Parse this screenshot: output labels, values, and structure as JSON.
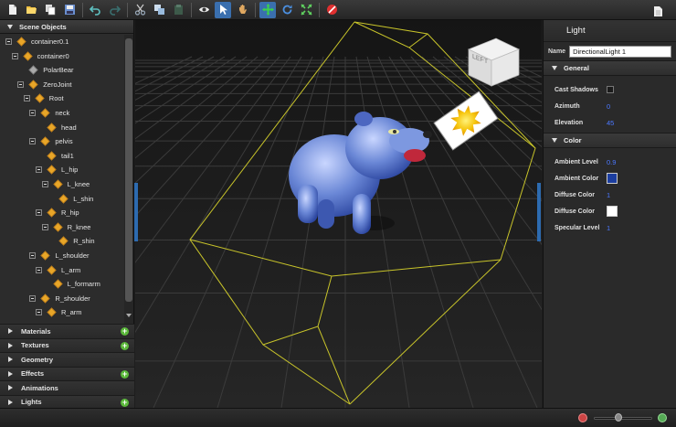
{
  "toolbar": {
    "buttons": [
      "new-file-icon",
      "open-folder-icon",
      "copy-icon",
      "save-icon",
      "undo-icon",
      "redo-icon",
      "cut-icon",
      "duplicate-icon",
      "paste-icon",
      "eye-icon",
      "select-arrow-icon",
      "pan-hand-icon",
      "move-icon",
      "rotate-icon",
      "scale-icon",
      "stop-icon"
    ],
    "active": "select-arrow-icon",
    "right_button": "document-icon"
  },
  "scene_objects": {
    "title": "Scene Objects",
    "tree": [
      {
        "label": "container0.1",
        "level": 0,
        "expandable": true,
        "icon": "cube-orange"
      },
      {
        "label": "container0",
        "level": 1,
        "expandable": true,
        "icon": "cube-orange"
      },
      {
        "label": "PolarBear",
        "level": 2,
        "expandable": false,
        "icon": "cube-gray"
      },
      {
        "label": "ZeroJoint",
        "level": 2,
        "expandable": true,
        "icon": "cube-orange"
      },
      {
        "label": "Root",
        "level": 3,
        "expandable": true,
        "icon": "cube-orange"
      },
      {
        "label": "neck",
        "level": 4,
        "expandable": true,
        "icon": "cube-orange"
      },
      {
        "label": "head",
        "level": 5,
        "expandable": false,
        "icon": "cube-orange"
      },
      {
        "label": "pelvis",
        "level": 4,
        "expandable": true,
        "icon": "cube-orange"
      },
      {
        "label": "tail1",
        "level": 5,
        "expandable": false,
        "icon": "cube-orange"
      },
      {
        "label": "L_hip",
        "level": 5,
        "expandable": true,
        "icon": "cube-orange"
      },
      {
        "label": "L_knee",
        "level": 6,
        "expandable": true,
        "icon": "cube-orange"
      },
      {
        "label": "L_shin",
        "level": 7,
        "expandable": false,
        "icon": "cube-orange"
      },
      {
        "label": "R_hip",
        "level": 5,
        "expandable": true,
        "icon": "cube-orange"
      },
      {
        "label": "R_knee",
        "level": 6,
        "expandable": true,
        "icon": "cube-orange"
      },
      {
        "label": "R_shin",
        "level": 7,
        "expandable": false,
        "icon": "cube-orange"
      },
      {
        "label": "L_shoulder",
        "level": 4,
        "expandable": true,
        "icon": "cube-orange"
      },
      {
        "label": "L_arm",
        "level": 5,
        "expandable": true,
        "icon": "cube-orange"
      },
      {
        "label": "L_formarm",
        "level": 6,
        "expandable": false,
        "icon": "cube-orange"
      },
      {
        "label": "R_shoulder",
        "level": 4,
        "expandable": true,
        "icon": "cube-orange"
      },
      {
        "label": "R_arm",
        "level": 5,
        "expandable": true,
        "icon": "cube-orange"
      }
    ]
  },
  "sections": [
    {
      "label": "Materials",
      "has_add": true
    },
    {
      "label": "Textures",
      "has_add": true
    },
    {
      "label": "Geometry",
      "has_add": false
    },
    {
      "label": "Effects",
      "has_add": true
    },
    {
      "label": "Animations",
      "has_add": false
    },
    {
      "label": "Lights",
      "has_add": true
    }
  ],
  "viewport": {
    "view_cube_label": "LEFT",
    "background": "#181818",
    "grid_color": "#3a3a3a",
    "frustum_color": "#c8c42a",
    "bear_color": "#5b78c8"
  },
  "properties": {
    "title": "Light",
    "name_label": "Name",
    "name_value": "DirectionalLight 1",
    "general": {
      "title": "General",
      "cast_shadows_label": "Cast Shadows",
      "cast_shadows": false,
      "azimuth_label": "Azimuth",
      "azimuth": "0",
      "elevation_label": "Elevation",
      "elevation": "45"
    },
    "color": {
      "title": "Color",
      "ambient_level_label": "Ambient Level",
      "ambient_level": "0.9",
      "ambient_color_label": "Ambient Color",
      "ambient_color": "#1c3ea0",
      "diffuse_color1_label": "Diffuse Color",
      "diffuse_color1": "1",
      "diffuse_color2_label": "Diffuse Color",
      "diffuse_color2": "#ffffff",
      "specular_level_label": "Specular Level",
      "specular_level": "1"
    }
  },
  "zoom": {
    "level": 0.38
  }
}
